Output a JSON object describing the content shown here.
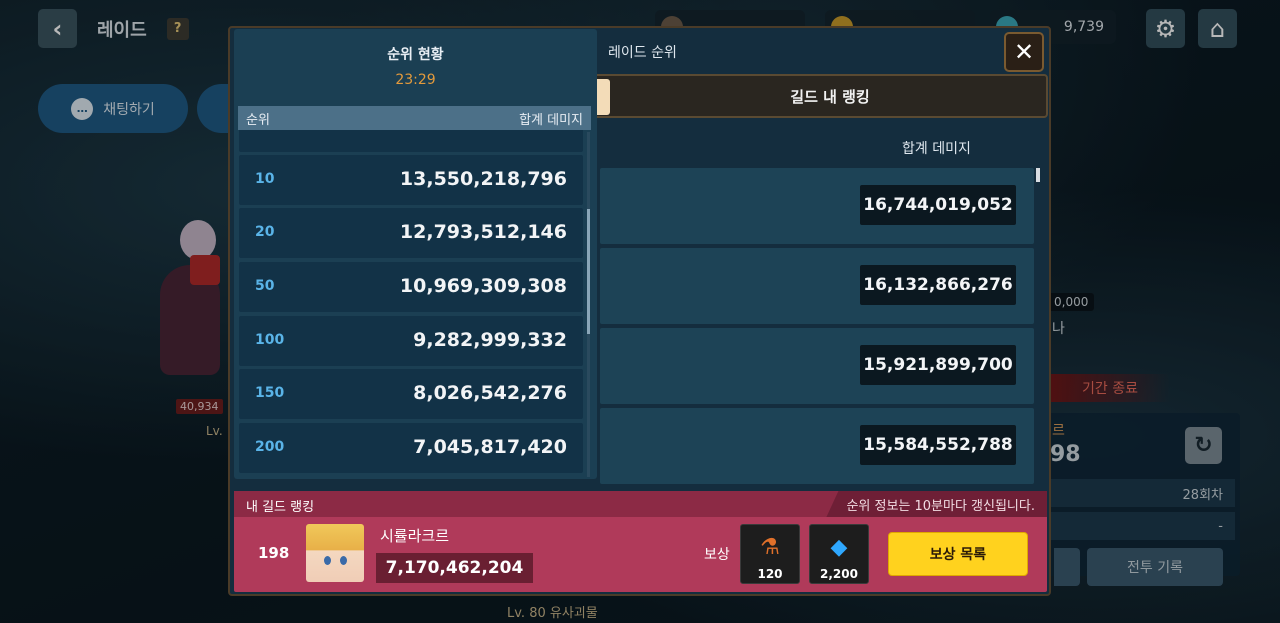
{
  "header": {
    "title": "레이드",
    "help_label": "?",
    "back_icon": "chevron-left-icon",
    "currency_c": "9,739",
    "settings_icon": "gear-icon",
    "home_icon": "home-icon"
  },
  "chat": {
    "label": "채팅하기"
  },
  "background": {
    "monster_hp": "40,934",
    "monster_level": "Lv.",
    "right_number": "0,000",
    "right_text": "나",
    "period_end": "기간 종료",
    "panel_title": "르",
    "panel_value": "98",
    "row1_value": "28회차",
    "row2_value": "-",
    "battle_log": "전투 기록",
    "bottom_monster": "Lv. 80 유사괴물"
  },
  "dialog": {
    "title": "레이드 순위",
    "tab_guild": "길드 내 랭킹",
    "dmg_header": "합계 데미지",
    "list_values": [
      "16,744,019,052",
      "16,132,866,276",
      "15,921,899,700",
      "15,584,552,788"
    ]
  },
  "ranking": {
    "title": "순위 현황",
    "time": "23:29",
    "col_rank": "순위",
    "col_dmg": "합계 데미지",
    "rows": [
      {
        "rank": "",
        "dmg": ""
      },
      {
        "rank": "10",
        "dmg": "13,550,218,796"
      },
      {
        "rank": "20",
        "dmg": "12,793,512,146"
      },
      {
        "rank": "50",
        "dmg": "10,969,309,308"
      },
      {
        "rank": "100",
        "dmg": "9,282,999,332"
      },
      {
        "rank": "150",
        "dmg": "8,026,542,276"
      },
      {
        "rank": "200",
        "dmg": "7,045,817,420"
      }
    ]
  },
  "my_guild": {
    "label": "내 길드 랭킹",
    "notice": "순위 정보는 10분마다 갱신됩니다.",
    "rank": "198",
    "name": "시률라크르",
    "damage": "7,170,462,204",
    "reward_label": "보상",
    "rewards": [
      {
        "icon": "potion-icon",
        "count": "120"
      },
      {
        "icon": "diamond-icon",
        "count": "2,200"
      }
    ],
    "reward_list_button": "보상 목록"
  }
}
